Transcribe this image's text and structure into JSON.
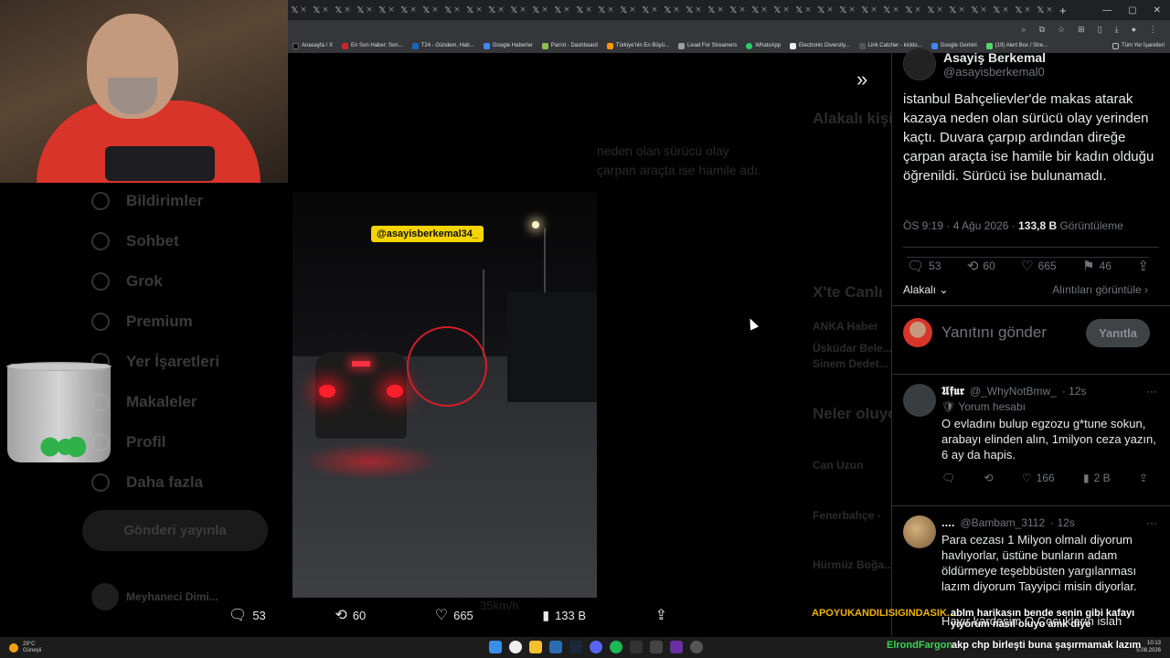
{
  "browser": {
    "bookmarks": [
      "Anasayfa / X",
      "En Son Haber: Son...",
      "T24 - Gündem, Hab...",
      "Google Haberler",
      "Parrot - Dashboard",
      "Türkiye'nin En Büyü...",
      "Livad For Streamers",
      "WhatsApp",
      "Electronic Diversity...",
      "Link Catcher - kicklo...",
      "Google Gemini",
      "(19) Alert Box / Stre..."
    ],
    "bookmarks_all": "Tüm Yer İşaretleri"
  },
  "sidebar": {
    "items": [
      "Bildirimler",
      "Sohbet",
      "Grok",
      "Premium",
      "Yer İşaretleri",
      "Makaleler",
      "Profil",
      "Daha fazla"
    ],
    "post_button": "Gönderi yayınla",
    "account_name": "Meyhaneci Dimi..."
  },
  "video": {
    "watermark": "@asayisberkemal34_",
    "speed": "35km/h"
  },
  "video_actions": {
    "replies": "53",
    "reposts": "60",
    "likes": "665",
    "views": "133 B"
  },
  "faded": {
    "snippet": "neden olan sürücü olay çarpan araçta ise hamile adı.",
    "related_title": "Alakalı kişiler",
    "xte": "X'te Canlı",
    "xte_item1": "ANKA Haber",
    "xte_item2": "Üsküdar Bele...",
    "xte_item3": "Sinem Dedet...",
    "neler": "Neler oluyor",
    "neler_item1": "Can Uzun",
    "neler_item2": "Fenerbahçe -",
    "neler_item3": "Hürmüz Boğa..."
  },
  "tweet": {
    "author_name": "Asayiş Berkemal",
    "author_handle": "@asayisberkemal0",
    "text": "istanbul Bahçelievler'de makas atarak kazaya neden olan sürücü olay yerinden kaçtı. Duvara çarpıp ardından direğe çarpan araçta ise hamile bir kadın olduğu öğrenildi. Sürücü ise bulunamadı.",
    "time": "ÖS 9:19 · 4 Ağu 2026 · ",
    "views_count": "133,8 B",
    "views_label": " Görüntüleme",
    "replies": "53",
    "reposts": "60",
    "likes": "665",
    "bookmarks": "46",
    "sort_label": "Alakalı",
    "quotes_label": "Alıntıları görüntüle",
    "reply_placeholder": "Yanıtını gönder",
    "reply_button": "Yanıtla"
  },
  "replies": [
    {
      "name": "𝖀𝖋𝖚𝖗",
      "handle": "@_WhyNotBmw_",
      "time": "· 12s",
      "badge": "Yorum hesabı",
      "text": "O evladını bulup egzozu g*tune sokun, arabayı elinden alın, 1milyon ceza yazın, 6 ay da hapis.",
      "likes": "166",
      "views": "2 B"
    },
    {
      "name": "....",
      "handle": "@Bambam_3112",
      "time": "· 12s",
      "text": "Para cezası 1 Milyon olmalı diyorum havlıyorlar, üstüne bunların adam öldürmeye teşebbüsten yargılanması lazım diyorum Tayyipci misin diyorlar."
    }
  ],
  "reply3_text": "Hayır kardeşim O.Cocukların islah",
  "chat": [
    {
      "user": "APOYUKANDILISIGINDASIK...",
      "message": "ablm harikasın bende senin gibi kafayı yiyorum nasıl oluyo amk diye"
    },
    {
      "user": "ElrondFargon",
      "message": "akp chp birleşti buna şaşırmamak lazım"
    }
  ],
  "taskbar": {
    "weather_temp": "29°C",
    "weather_label": "Güneşli",
    "time": "10:13",
    "date": "5.08.2026"
  },
  "colors": {
    "accent": "#1d9bf0",
    "chat_user1": "#f0b400",
    "chat_user2": "#3cd05a"
  }
}
